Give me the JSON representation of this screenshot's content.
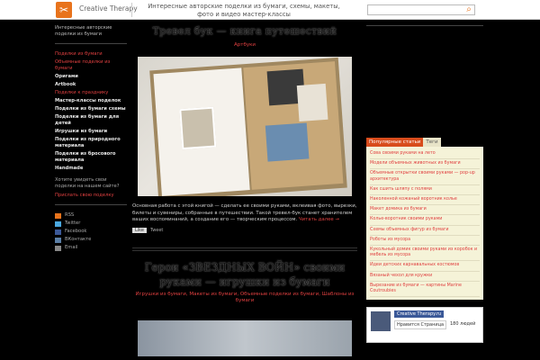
{
  "topbar": {
    "site_name": "Creative Therapy",
    "tagline": "Интересные авторские поделки из бумаги, схемы, макеты, фото и видео мастер-классы"
  },
  "left": {
    "intro": "Интересные авторские поделки из бумаги",
    "nav": [
      {
        "label": "Поделки из бумаги",
        "bold": false
      },
      {
        "label": "Объемные поделки из бумаги",
        "bold": false
      },
      {
        "label": "Оригами",
        "bold": true
      },
      {
        "label": "Artbook",
        "bold": true
      },
      {
        "label": "Поделки к празднику",
        "bold": false
      },
      {
        "label": "Мастер-классы поделок",
        "bold": true
      },
      {
        "label": "Поделки из бумаги схемы",
        "bold": true
      },
      {
        "label": "Поделки из бумаги для детей",
        "bold": true
      },
      {
        "label": "Игрушки из бумаги",
        "bold": true
      },
      {
        "label": "Поделки из природного материала",
        "bold": true
      },
      {
        "label": "Поделки из бросового материала",
        "bold": true
      },
      {
        "label": "Handmade",
        "bold": true
      }
    ],
    "block_text": "Хотите увидеть свои поделки на нашем сайте?",
    "block_link": "Прислать свою поделку",
    "social": [
      "RSS",
      "Twitter",
      "Facebook",
      "ВКонтакте",
      "Email"
    ]
  },
  "post1": {
    "title": "Тревел бук — книга путешествий",
    "category": "Артбуки",
    "text": "Основная работа с этой книгой — сделать ее своими руками, вклеивая фото, вырезки, билеты и сувениры, собранные в путешествии. Такой тревел-бук станет хранителем ваших воспоминаний, а создание его — творческим процессом.",
    "more": "Читать далее →",
    "share_label": "Like",
    "tweet_label": "Tweet"
  },
  "post2": {
    "title": "Герои «ЗВЕЗДНЫХ ВОЙН» своими руками — игрушки из бумаги",
    "category": "Игрушки из бумаги, Макеты из бумаги, Объемные поделки из бумаги, Шаблоны из бумаги"
  },
  "right": {
    "tab_active": "Популярные статьи",
    "tab": "Теги",
    "popular": [
      "Сова своими руками на лето",
      "Модели объемных животных из бумаги",
      "Объемные открытки своими руками — pop-up архитектура",
      "Как сшить шляпу с полями",
      "Наколенной кожаный воротник колье",
      "Макет домика из бумаги",
      "Колье-воротник своими руками",
      "Схемы объемных фигур из бумаги",
      "Роботы из мусора",
      "Кукольный домик своими руками из коробок и мебель из мусора",
      "Идеи детских карнавальных костюмов",
      "Вязаный чехол для кружки",
      "Вырезание из бумаги — картины Marine Coutroubies"
    ],
    "fb_name": "Creative Therapy.ru",
    "fb_like": "Нравится Страница",
    "fb_count": "180 людей"
  }
}
